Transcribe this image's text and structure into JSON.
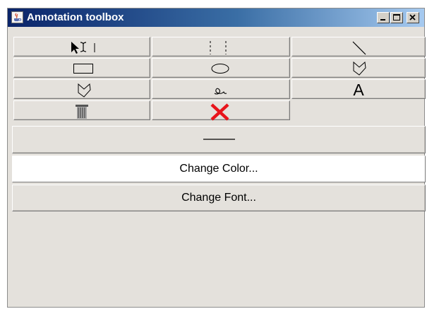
{
  "window": {
    "title": "Annotation toolbox",
    "icon": "java-coffee-cup-icon",
    "controls": [
      "minimize-icon",
      "maximize-icon",
      "close-icon"
    ]
  },
  "tools": [
    {
      "id": "select",
      "icon": "select-arrow-text-cursor-icon"
    },
    {
      "id": "dashed-line",
      "icon": "dashed-lines-icon"
    },
    {
      "id": "line",
      "icon": "diagonal-line-icon"
    },
    {
      "id": "rectangle",
      "icon": "rectangle-icon"
    },
    {
      "id": "ellipse",
      "icon": "ellipse-icon"
    },
    {
      "id": "polygon",
      "icon": "polygon-icon"
    },
    {
      "id": "filled-polygon",
      "icon": "polygon-icon"
    },
    {
      "id": "freehand",
      "icon": "freehand-loop-icon"
    },
    {
      "id": "text",
      "icon": "text-icon",
      "glyph": "A"
    },
    {
      "id": "trash",
      "icon": "trash-can-icon"
    },
    {
      "id": "delete",
      "icon": "delete-x-icon",
      "color": "#e8141b"
    }
  ],
  "line_width": {
    "icon": "line-width-icon"
  },
  "actions": {
    "change_color": "Change Color...",
    "change_font": "Change Font..."
  }
}
